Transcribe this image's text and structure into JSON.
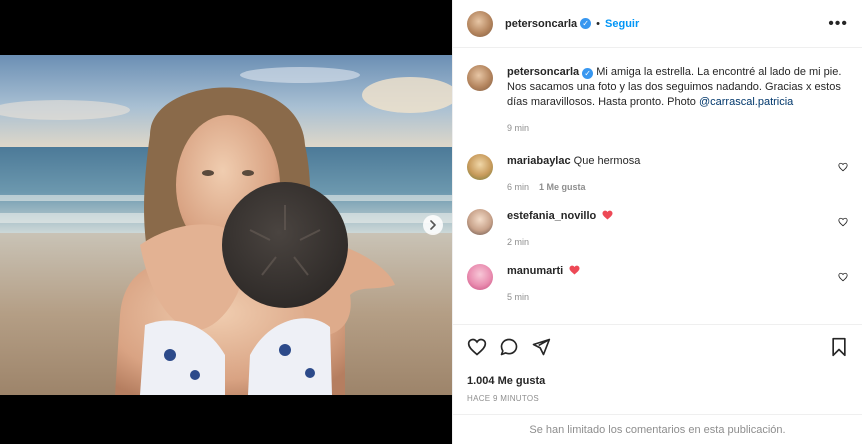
{
  "post": {
    "username": "petersoncarla",
    "follow_label": "Seguir",
    "more_label": "•••"
  },
  "caption": {
    "username": "petersoncarla",
    "text": "Mi amiga la estrella. La encontré al lado de mi pie. Nos sacamos una foto y las dos seguimos nadando. Gracias x estos días maravillosos. Hasta pronto. Photo ",
    "mention": "@carrascal.patricia",
    "time": "9 min"
  },
  "comments": [
    {
      "username": "mariabaylac",
      "text": "Que hermosa",
      "time": "6 min",
      "likes": "1 Me gusta",
      "has_heart_emoji": false
    },
    {
      "username": "estefania_novillo",
      "text": "",
      "time": "2 min",
      "likes": "",
      "has_heart_emoji": true
    },
    {
      "username": "manumarti",
      "text": "",
      "time": "5 min",
      "likes": "",
      "has_heart_emoji": true
    }
  ],
  "engagement": {
    "likes": "1.004 Me gusta",
    "timestamp": "Hace 9 minutos"
  },
  "footer": {
    "limited_text": "Se han limitado los comentarios en esta publicación."
  },
  "colors": {
    "link_blue": "#0095f6",
    "verified_blue": "#3897f0",
    "heart_red": "#ed4956",
    "muted": "#8e8e8e"
  },
  "icons": [
    "verified-badge-icon",
    "more-options-icon",
    "like-heart-icon",
    "comment-icon",
    "share-icon",
    "save-bookmark-icon",
    "next-arrow-icon"
  ]
}
